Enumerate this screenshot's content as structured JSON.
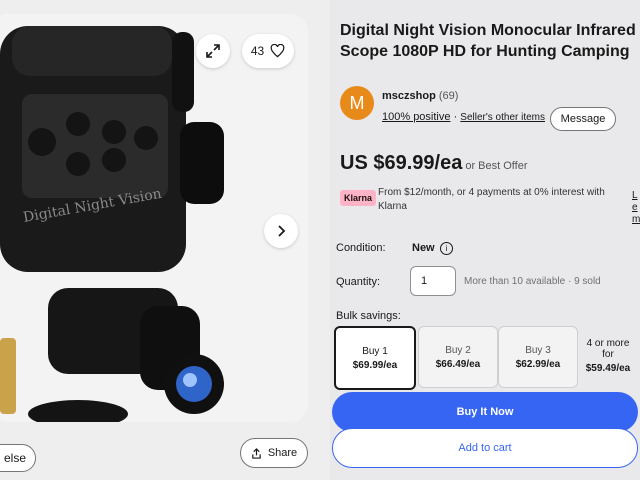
{
  "gallery": {
    "watch_count": "43",
    "share_label": "Share",
    "clipped_button_label": "else",
    "product_print_text": "Digital Night Vision"
  },
  "listing": {
    "title": "Digital Night Vision Monocular Infrared Scope 1080P HD for Hunting Camping"
  },
  "seller": {
    "avatar_letter": "M",
    "name": "msczshop",
    "feedback_count": "(69)",
    "positive": "100% positive",
    "separator": "·",
    "other_items": "Seller's other items",
    "message_label": "Message"
  },
  "price": {
    "amount": "US $69.99/ea",
    "best_offer": "or Best Offer"
  },
  "klarna": {
    "badge": "Klarna",
    "text": "From $12/month, or 4 payments at 0% interest with Klarna",
    "clipped_link": "Le m"
  },
  "condition": {
    "label": "Condition:",
    "value": "New"
  },
  "quantity": {
    "label": "Quantity:",
    "value": "1",
    "availability": "More than 10 available · 9 sold"
  },
  "bulk": {
    "label": "Bulk savings:",
    "options": [
      {
        "qty": "Buy 1",
        "price": "$69.99/ea"
      },
      {
        "qty": "Buy 2",
        "price": "$66.49/ea"
      },
      {
        "qty": "Buy 3",
        "price": "$62.99/ea"
      },
      {
        "qty": "4 or more for",
        "price": "$59.49/ea"
      }
    ]
  },
  "actions": {
    "buy_now": "Buy It Now",
    "add_to_cart": "Add to cart"
  },
  "colors": {
    "primary": "#3665f3",
    "avatar": "#e88a19",
    "klarna": "#ffb3c7"
  }
}
